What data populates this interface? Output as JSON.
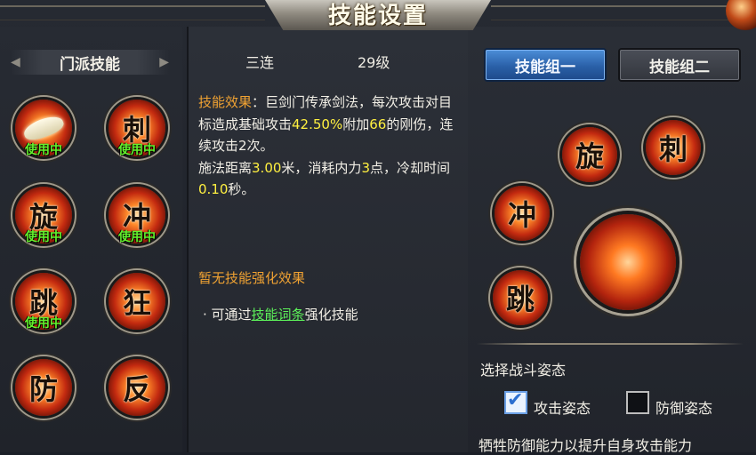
{
  "window": {
    "title": "技能设置"
  },
  "left": {
    "header": "门派技能",
    "skills": [
      {
        "glyph": "",
        "icon": "sword-slash-icon",
        "status": "使用中"
      },
      {
        "glyph": "刺",
        "icon": "thrust-skill-icon",
        "status": "使用中"
      },
      {
        "glyph": "旋",
        "icon": "spin-skill-icon",
        "status": "使用中"
      },
      {
        "glyph": "冲",
        "icon": "charge-skill-icon",
        "status": "使用中"
      },
      {
        "glyph": "跳",
        "icon": "jump-skill-icon",
        "status": "使用中"
      },
      {
        "glyph": "狂",
        "icon": "frenzy-skill-icon",
        "status": ""
      },
      {
        "glyph": "防",
        "icon": "defend-skill-icon",
        "status": ""
      },
      {
        "glyph": "反",
        "icon": "counter-skill-icon",
        "status": ""
      }
    ]
  },
  "middle": {
    "skill_name": "三连",
    "skill_level": "29级",
    "desc_label": "技能效果",
    "desc_p1": "：巨剑门传承剑法，每次攻击对目标造成基础攻击",
    "desc_v1": "42.50%",
    "desc_p2": "附加",
    "desc_v2": "66",
    "desc_p3": "的刚伤，连续攻击2次。",
    "desc_p4": "施法距离",
    "desc_v3": "3.00",
    "desc_p5": "米，消耗内力",
    "desc_v4": "3",
    "desc_p6": "点，冷却时间",
    "desc_v5": "0.10",
    "desc_p7": "秒。",
    "no_enhance": "暂无技能强化效果",
    "hint_prefix": "· 可通过",
    "hint_link": "技能词条",
    "hint_suffix": "强化技能"
  },
  "right": {
    "tabs": [
      {
        "label": "技能组一",
        "active": true
      },
      {
        "label": "技能组二",
        "active": false
      }
    ],
    "slots": [
      {
        "glyph": "旋",
        "icon": "spin-skill-icon"
      },
      {
        "glyph": "刺",
        "icon": "thrust-skill-icon"
      },
      {
        "glyph": "冲",
        "icon": "charge-skill-icon"
      },
      {
        "glyph": "跳",
        "icon": "jump-skill-icon"
      }
    ],
    "main_skill_icon": "sword-slash-icon",
    "stance_title": "选择战斗姿态",
    "attack_stance": "攻击姿态",
    "defense_stance": "防御姿态",
    "attack_checked": true,
    "defense_checked": false,
    "stance_desc": "牺牲防御能力以提升自身攻击能力"
  },
  "colors": {
    "in_use": "#63f02d",
    "highlight": "#fff040",
    "label": "#f0a232",
    "active_tab": "#2a60a8"
  }
}
